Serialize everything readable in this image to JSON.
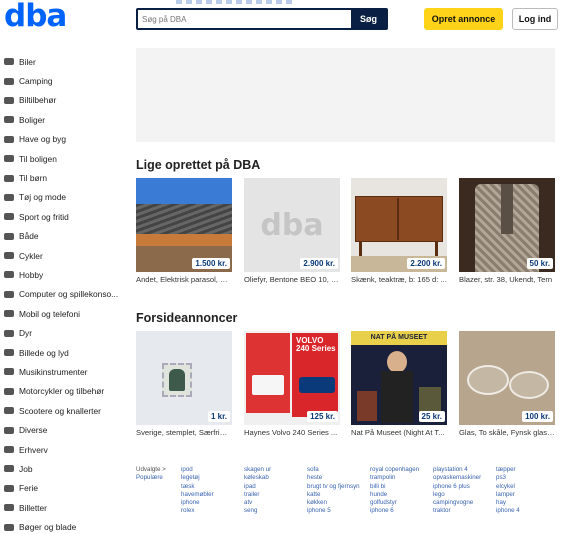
{
  "header": {
    "logo": "dba",
    "search_placeholder": "Søg på DBA",
    "search_button": "Søg",
    "create_button": "Opret annonce",
    "login_button": "Log ind"
  },
  "sidebar": [
    {
      "label": "Biler",
      "icon": "car-icon"
    },
    {
      "label": "Camping",
      "icon": "caravan-icon"
    },
    {
      "label": "Biltilbehør",
      "icon": "tire-icon"
    },
    {
      "label": "Boliger",
      "icon": "house-icon"
    },
    {
      "label": "Have og byg",
      "icon": "wheelbarrow-icon"
    },
    {
      "label": "Til boligen",
      "icon": "lamp-icon"
    },
    {
      "label": "Til børn",
      "icon": "stroller-icon"
    },
    {
      "label": "Tøj og mode",
      "icon": "shirt-icon"
    },
    {
      "label": "Sport og fritid",
      "icon": "ball-icon"
    },
    {
      "label": "Både",
      "icon": "boat-icon"
    },
    {
      "label": "Cykler",
      "icon": "bicycle-icon"
    },
    {
      "label": "Hobby",
      "icon": "scissors-icon"
    },
    {
      "label": "Computer og spillekonso...",
      "icon": "computer-icon"
    },
    {
      "label": "Mobil og telefoni",
      "icon": "phone-icon"
    },
    {
      "label": "Dyr",
      "icon": "paw-icon"
    },
    {
      "label": "Billede og lyd",
      "icon": "tv-icon"
    },
    {
      "label": "Musikinstrumenter",
      "icon": "guitar-icon"
    },
    {
      "label": "Motorcykler og tilbehør",
      "icon": "motorcycle-icon"
    },
    {
      "label": "Scootere og knallerter",
      "icon": "scooter-icon"
    },
    {
      "label": "Diverse",
      "icon": "box-icon"
    },
    {
      "label": "Erhverv",
      "icon": "briefcase-icon"
    },
    {
      "label": "Job",
      "icon": "job-icon"
    },
    {
      "label": "Ferie",
      "icon": "palm-icon"
    },
    {
      "label": "Billetter",
      "icon": "ticket-icon"
    },
    {
      "label": "Bøger og blade",
      "icon": "book-icon"
    }
  ],
  "sections": {
    "latest_title": "Lige oprettet på DBA",
    "latest": [
      {
        "price": "1.500 kr.",
        "caption": "Andet, Elektrisk parasol, El...",
        "image": "awning-photo"
      },
      {
        "price": "2.900 kr.",
        "caption": "Oliefyr, Bentone BEO 10, K...",
        "image": "dba-placeholder"
      },
      {
        "price": "2.200 kr.",
        "caption": "Skænk, teaktræ, b: 165 d: ...",
        "image": "sideboard-photo"
      },
      {
        "price": "50 kr.",
        "caption": "Blazer, str. 38, Ukendt, Tern",
        "image": "blazer-photo"
      }
    ],
    "front_title": "Forsideannoncer",
    "front": [
      {
        "price": "1 kr.",
        "caption": "Sverige, stemplet, Særfrim...",
        "image": "stamp-photo"
      },
      {
        "price": "125 kr.",
        "caption": "Haynes Volvo 240 Series ...",
        "image": "manual-photo"
      },
      {
        "price": "25 kr.",
        "caption": "Nat På Museet (Night At T...",
        "image": "dvd-photo"
      },
      {
        "price": "100 kr.",
        "caption": "Glas, To skåle, Fynsk glasv...",
        "image": "glass-photo"
      }
    ]
  },
  "footer": {
    "columns": [
      [
        "Udvalgte >",
        "Populære"
      ],
      [
        "ipod",
        "legetøj",
        "tæsk",
        "havemøbler",
        "iphone",
        "rolex"
      ],
      [
        "skagen ur",
        "køleskab",
        "ipad",
        "trailer",
        "atv",
        "seng"
      ],
      [
        "sofa",
        "hestе",
        "brugt tv og fjernsyn",
        "katte",
        "køkken",
        "iphone 5"
      ],
      [
        "royal copenhagen",
        "trampolin",
        "billi bi",
        "hunde",
        "golfudstyr",
        "iphone 6"
      ],
      [
        "playstation 4",
        "opvaskemaskiner",
        "iphone 6 plus",
        "lego",
        "campingvogne",
        "traktor"
      ],
      [
        "tæpper",
        "ps3",
        "elcykel",
        "lamper",
        "hay",
        "iphone 4"
      ]
    ]
  },
  "colors": {
    "brand": "#0063fb",
    "navy": "#0a1f44",
    "yellow": "#ffd31a",
    "link": "#3a64b0"
  }
}
